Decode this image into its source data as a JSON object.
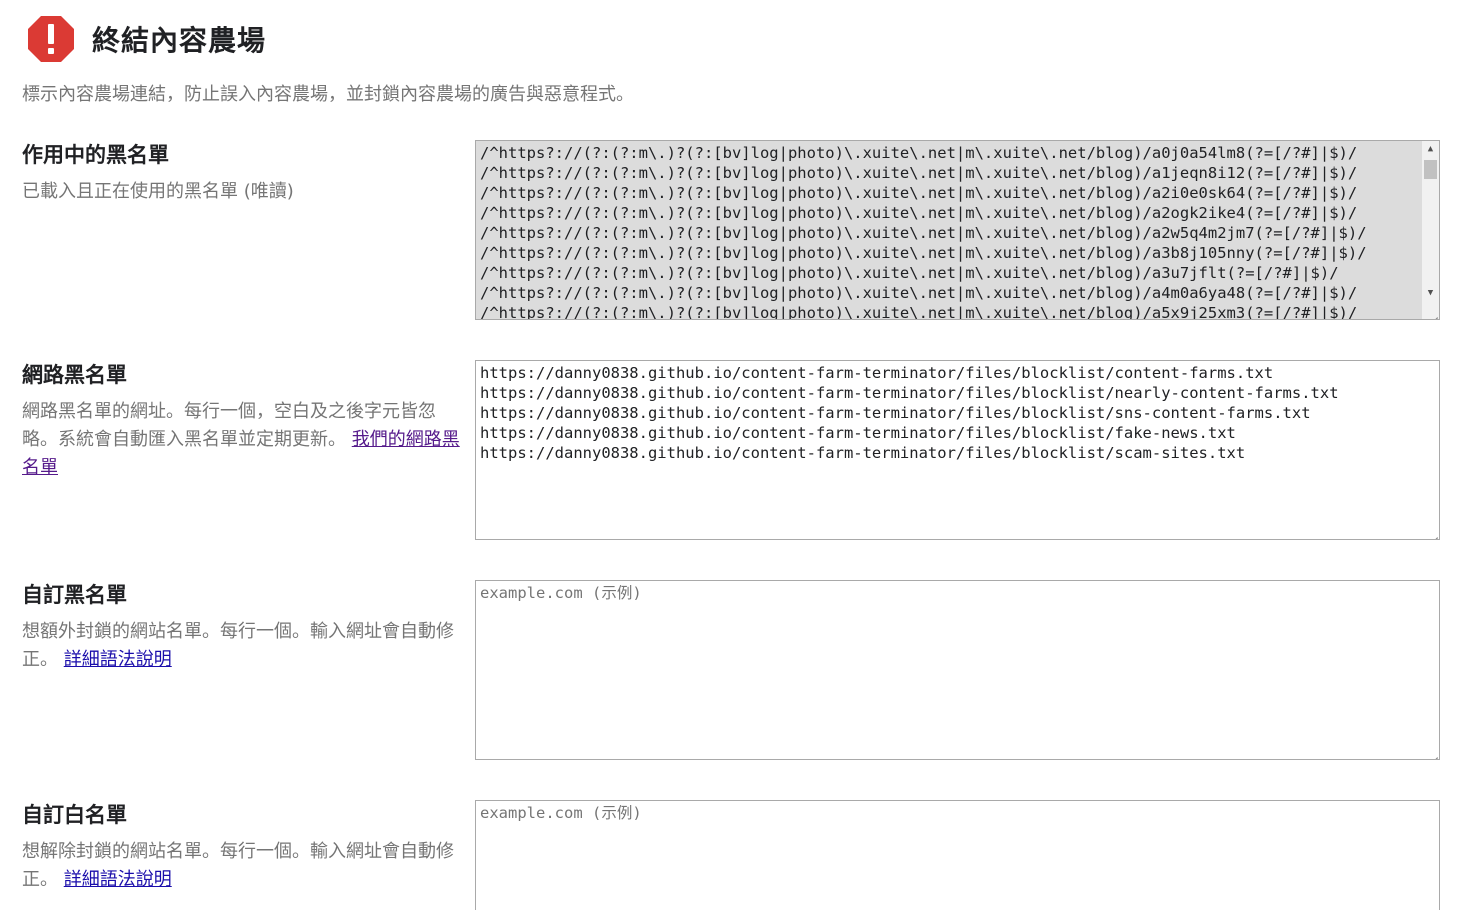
{
  "app": {
    "title": "終結內容農場",
    "description": "標示內容農場連結，防止誤入內容農場，並封鎖內容農場的廣告與惡意程式。",
    "logo_icon": "alert-octagon-icon",
    "logo_color": "#db3a34"
  },
  "active_blacklist": {
    "title": "作用中的黑名單",
    "description": "已載入且正在使用的黑名單 (唯讀)",
    "lines": [
      "/^https?://(?:(?:m\\.)?(?:[bv]log|photo)\\.xuite\\.net|m\\.xuite\\.net/blog)/a0j0a54lm8(?=[/?#]|$)/",
      "/^https?://(?:(?:m\\.)?(?:[bv]log|photo)\\.xuite\\.net|m\\.xuite\\.net/blog)/a1jeqn8i12(?=[/?#]|$)/",
      "/^https?://(?:(?:m\\.)?(?:[bv]log|photo)\\.xuite\\.net|m\\.xuite\\.net/blog)/a2i0e0sk64(?=[/?#]|$)/",
      "/^https?://(?:(?:m\\.)?(?:[bv]log|photo)\\.xuite\\.net|m\\.xuite\\.net/blog)/a2ogk2ike4(?=[/?#]|$)/",
      "/^https?://(?:(?:m\\.)?(?:[bv]log|photo)\\.xuite\\.net|m\\.xuite\\.net/blog)/a2w5q4m2jm7(?=[/?#]|$)/",
      "/^https?://(?:(?:m\\.)?(?:[bv]log|photo)\\.xuite\\.net|m\\.xuite\\.net/blog)/a3b8j105nny(?=[/?#]|$)/",
      "/^https?://(?:(?:m\\.)?(?:[bv]log|photo)\\.xuite\\.net|m\\.xuite\\.net/blog)/a3u7jflt(?=[/?#]|$)/",
      "/^https?://(?:(?:m\\.)?(?:[bv]log|photo)\\.xuite\\.net|m\\.xuite\\.net/blog)/a4m0a6ya48(?=[/?#]|$)/",
      "/^https?://(?:(?:m\\.)?(?:[bv]log|photo)\\.xuite\\.net|m\\.xuite\\.net/blog)/a5x9j25xm3(?=[/?#]|$)/"
    ]
  },
  "web_blacklist": {
    "title": "網路黑名單",
    "description": "網路黑名單的網址。每行一個，空白及之後字元皆忽略。系統會自動匯入黑名單並定期更新。",
    "link_text": "我們的網路黑名單",
    "lines": [
      "https://danny0838.github.io/content-farm-terminator/files/blocklist/content-farms.txt",
      "https://danny0838.github.io/content-farm-terminator/files/blocklist/nearly-content-farms.txt",
      "https://danny0838.github.io/content-farm-terminator/files/blocklist/sns-content-farms.txt",
      "https://danny0838.github.io/content-farm-terminator/files/blocklist/fake-news.txt",
      "https://danny0838.github.io/content-farm-terminator/files/blocklist/scam-sites.txt"
    ]
  },
  "custom_blacklist": {
    "title": "自訂黑名單",
    "description": "想額外封鎖的網站名單。每行一個。輸入網址會自動修正。",
    "link_text": "詳細語法說明",
    "placeholder": "example.com (示例)"
  },
  "custom_whitelist": {
    "title": "自訂白名單",
    "description": "想解除封鎖的網站名單。每行一個。輸入網址會自動修正。",
    "link_text": "詳細語法說明",
    "placeholder": "example.com (示例)"
  }
}
